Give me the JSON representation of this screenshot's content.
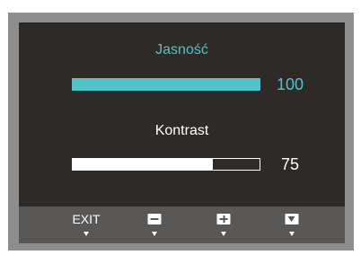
{
  "osd": {
    "brightness": {
      "label": "Jasność",
      "value": "100",
      "fill_fraction": 1.0
    },
    "contrast": {
      "label": "Kontrast",
      "value": "75",
      "fill_fraction": 0.75
    }
  },
  "buttons": {
    "exit_label": "EXIT",
    "minus_icon": "minus-icon",
    "plus_icon": "plus-icon",
    "down_icon": "down-arrow-icon"
  },
  "colors": {
    "accent": "#4fc3c8",
    "panel": "#2e2a27",
    "frame": "#8e8e8e",
    "button_bar": "#595756"
  }
}
